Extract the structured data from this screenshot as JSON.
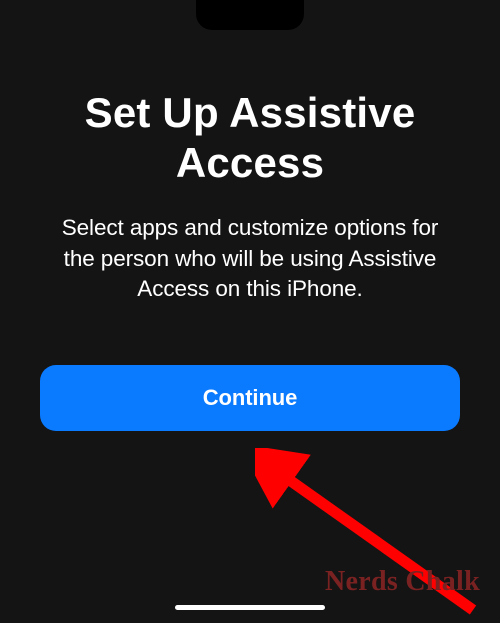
{
  "page": {
    "title": "Set Up Assistive Access",
    "description": "Select apps and customize options for the person who will be using Assistive Access on this iPhone.",
    "continue_label": "Continue"
  },
  "watermark": {
    "text": "Nerds Chalk"
  },
  "colors": {
    "background": "#141414",
    "accent": "#0a7aff",
    "annotation": "#ff0000",
    "watermark": "#7a2222"
  }
}
